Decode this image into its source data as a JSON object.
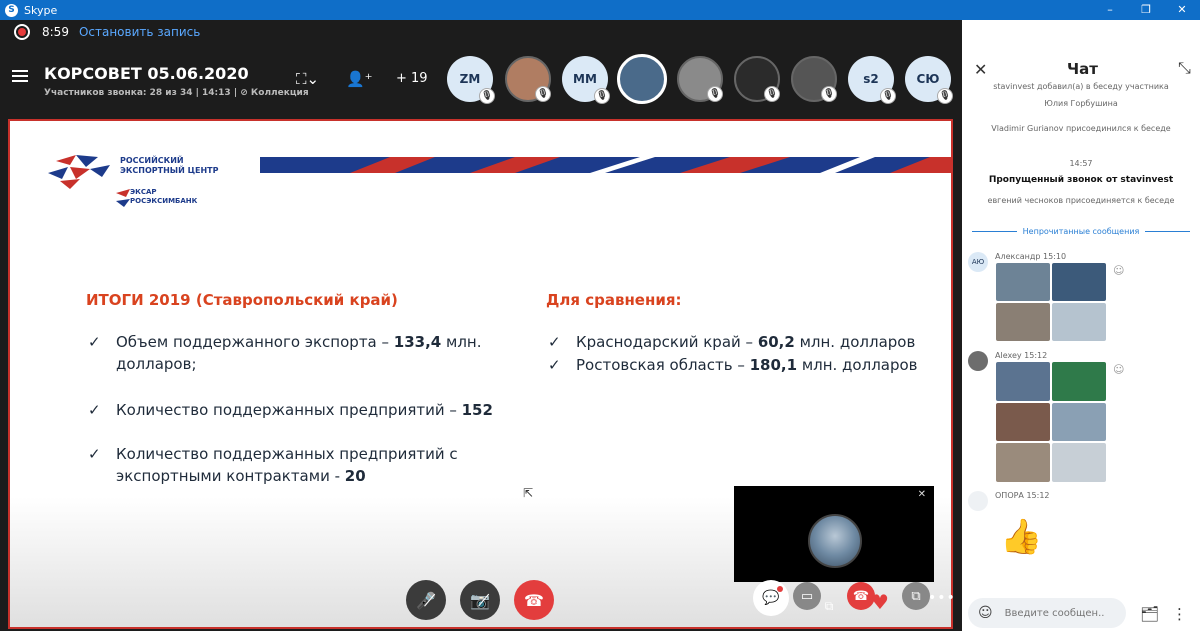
{
  "window": {
    "title": "Skype",
    "min": "–",
    "max": "❐",
    "close": "✕"
  },
  "recording": {
    "time": "8:59",
    "stop_label": "Остановить запись"
  },
  "call": {
    "title": "КОРСОВЕТ 05.06.2020",
    "subtitle": "Участников звонка: 28 из 34 | 14:13 | ⊘ Коллекция",
    "add_count": "+ 19",
    "participants": [
      {
        "initials": "ZM",
        "kind": "initials"
      },
      {
        "initials": "",
        "kind": "photo",
        "color": "#b07d62"
      },
      {
        "initials": "MM",
        "kind": "initials"
      },
      {
        "initials": "",
        "kind": "photo-active",
        "color": "#4a6a8a"
      },
      {
        "initials": "",
        "kind": "photo",
        "color": "#8a8a8a"
      },
      {
        "initials": "",
        "kind": "photo",
        "color": "#2b2b2b"
      },
      {
        "initials": "",
        "kind": "photo",
        "color": "#555555"
      },
      {
        "initials": "s2",
        "kind": "initials"
      },
      {
        "initials": "СЮ",
        "kind": "initials"
      }
    ]
  },
  "slide": {
    "logo_line1": "РОССИЙСКИЙ",
    "logo_line2": "ЭКСПОРТНЫЙ ЦЕНТР",
    "logo_line3": "ЭКСАР",
    "logo_line4": "РОСЭКСИМБАНК",
    "left_heading": "ИТОГИ 2019 (Ставропольский край)",
    "left_items": [
      {
        "text1": "Объем поддержанного экспорта – ",
        "bold": "133,4",
        "text2": " млн.",
        "line2": "долларов;"
      },
      {
        "text1": "Количество поддержанных предприятий – ",
        "bold": "152"
      },
      {
        "text1": "Количество поддержанных предприятий с",
        "line2a": "экспортными контрактами - ",
        "bold": "20"
      }
    ],
    "right_heading": "Для сравнения:",
    "right_items": [
      {
        "text1": "Краснодарский край – ",
        "bold": "60,2",
        "text2": " млн. долларов"
      },
      {
        "text1": "Ростовская область – ",
        "bold": "180,1",
        "text2": " млн. долларов"
      }
    ]
  },
  "selfview": {
    "close": "✕"
  },
  "chat": {
    "title": "Чат",
    "history": [
      {
        "text": "stavinvest добавил(а) в беседу участника",
        "strong": false
      },
      {
        "text": "Юлия Горбушина",
        "strong": false
      },
      {
        "text": "Vladimir Gurianov присоединился к беседе",
        "strong": false
      },
      {
        "text": "14:57",
        "strong": false
      },
      {
        "text": "Пропущенный звонок от stavinvest",
        "strong": true
      },
      {
        "text": "евгений чесноков присоединяется к беседе",
        "strong": false
      }
    ],
    "unread_label": "Непрочитанные сообщения",
    "messages": [
      {
        "avatar": "АЮ",
        "name": "Александр 15:10"
      },
      {
        "avatar": "",
        "name": "Alexey 15:12"
      },
      {
        "avatar": "",
        "name": "ОПОРА 15:12"
      }
    ],
    "input_placeholder": "Введите сообщен..."
  }
}
